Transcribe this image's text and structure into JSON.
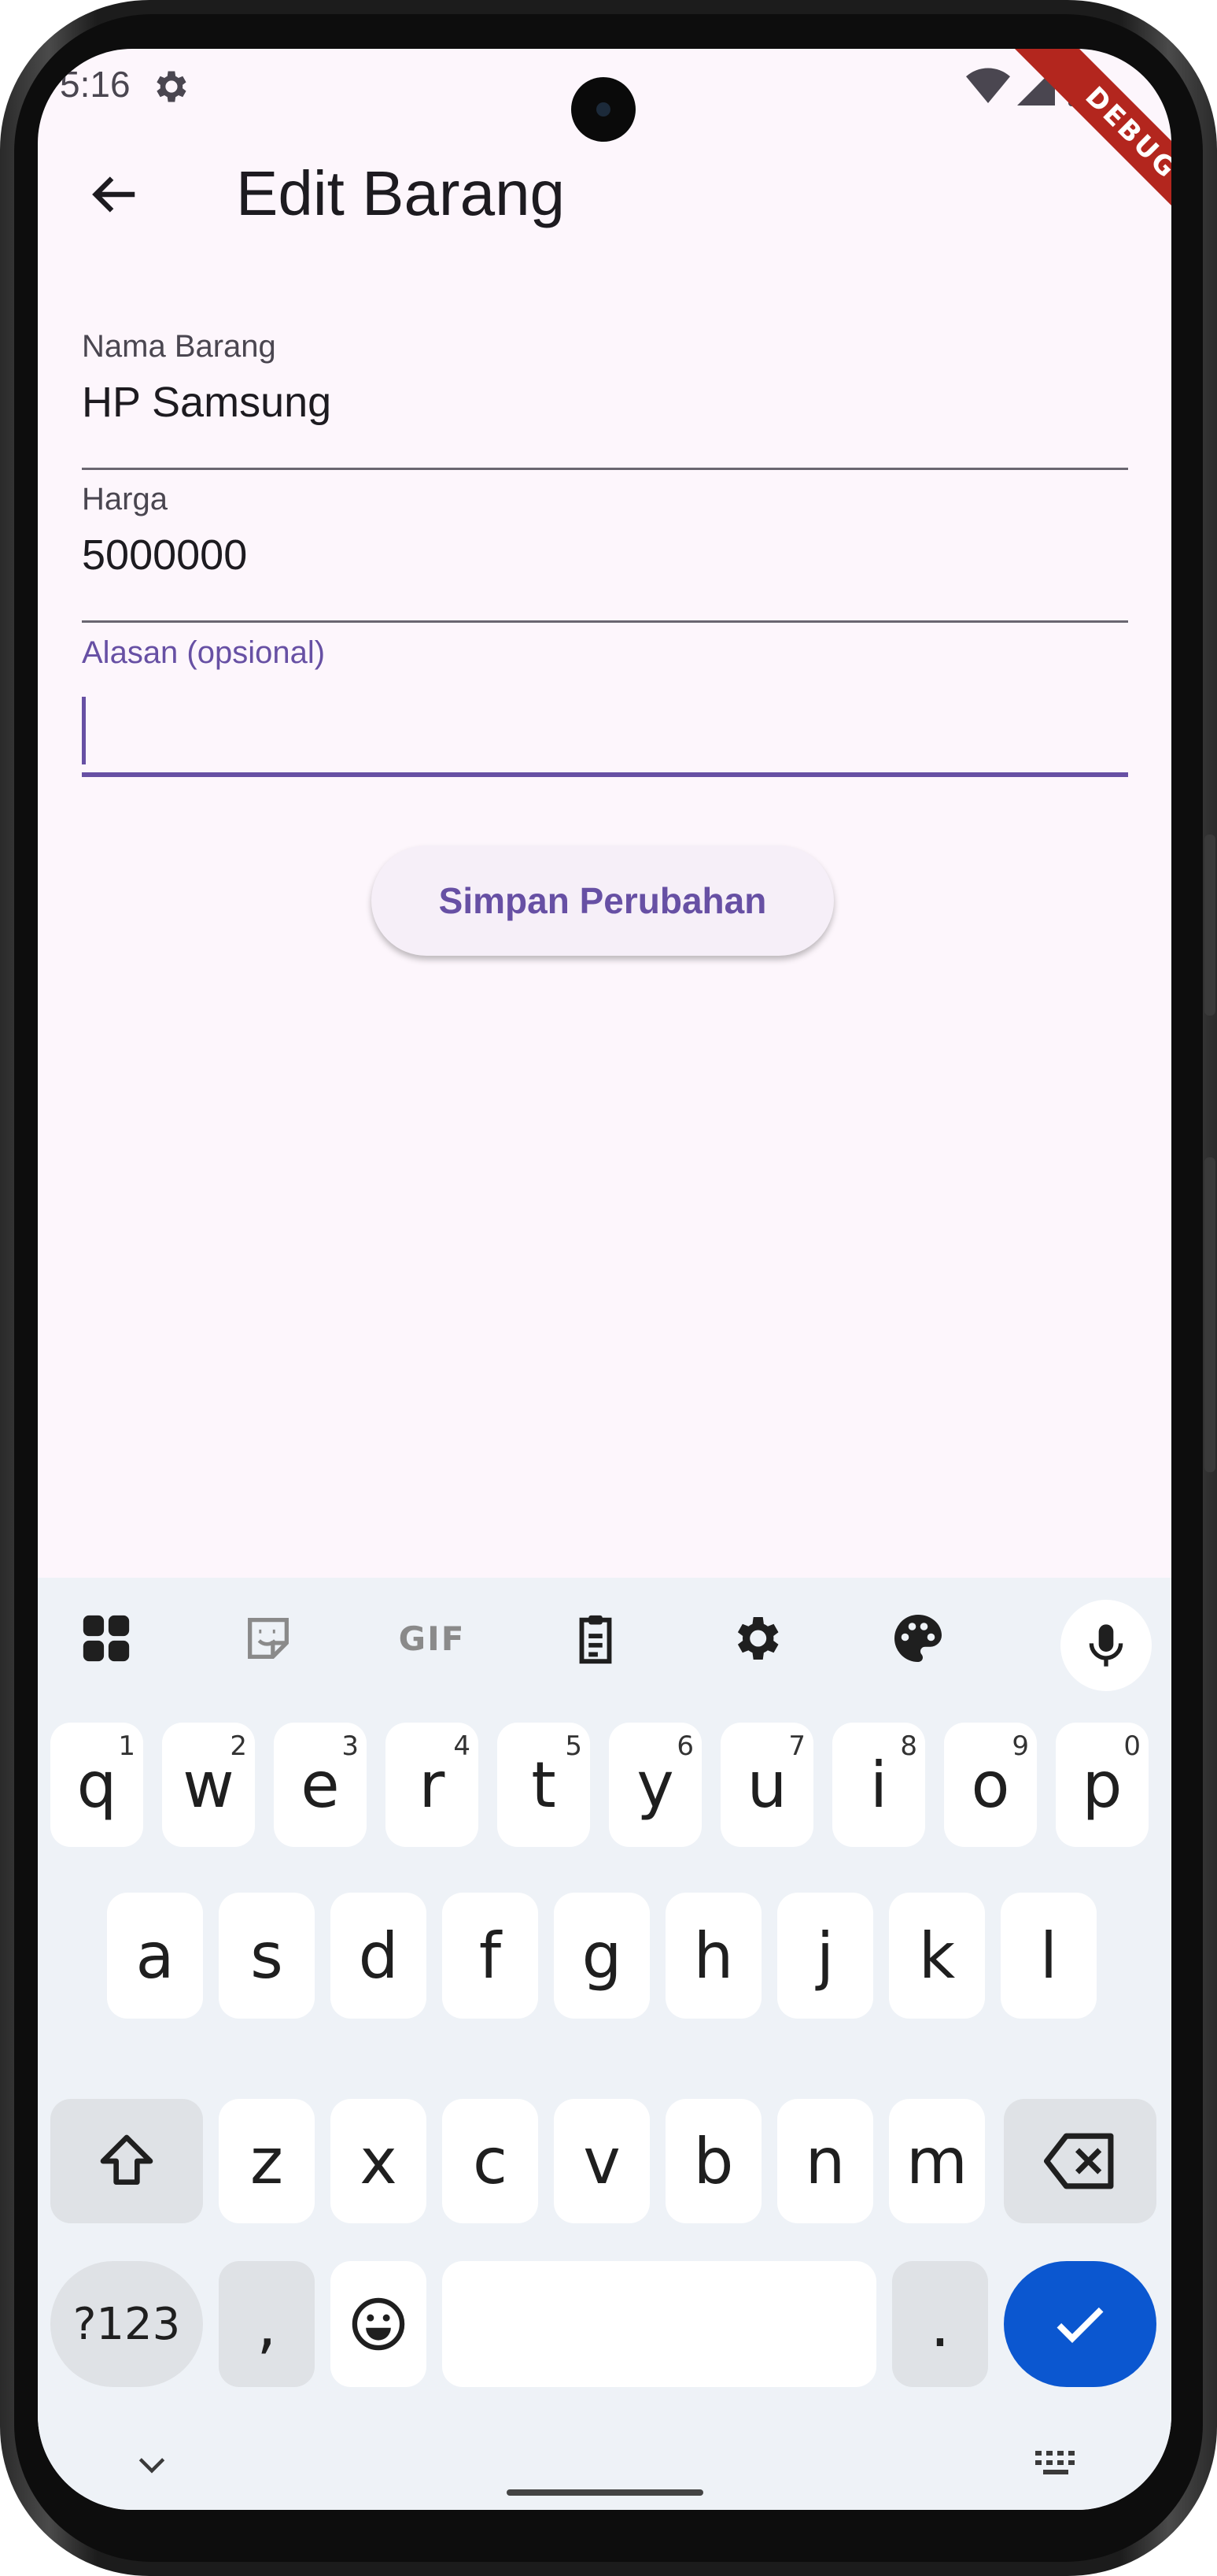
{
  "status_bar": {
    "time": "5:16"
  },
  "debug_banner": "DEBUG",
  "app_bar": {
    "title": "Edit Barang"
  },
  "form": {
    "nama_barang": {
      "label": "Nama Barang",
      "value": "HP Samsung"
    },
    "harga": {
      "label": "Harga",
      "value": "5000000"
    },
    "alasan": {
      "label": "Alasan (opsional)",
      "value": ""
    },
    "submit_label": "Simpan Perubahan"
  },
  "colors": {
    "accent": "#6750a4",
    "background": "#fdf6fc",
    "keyboard_bg": "#eef2f7",
    "enter_key": "#0b57d0"
  },
  "keyboard": {
    "toolbar_icons": [
      "apps-icon",
      "sticker-icon",
      "gif-icon",
      "clipboard-icon",
      "settings-icon",
      "palette-icon",
      "mic-icon"
    ],
    "gif_label": "GIF",
    "row1": [
      {
        "k": "q",
        "h": "1"
      },
      {
        "k": "w",
        "h": "2"
      },
      {
        "k": "e",
        "h": "3"
      },
      {
        "k": "r",
        "h": "4"
      },
      {
        "k": "t",
        "h": "5"
      },
      {
        "k": "y",
        "h": "6"
      },
      {
        "k": "u",
        "h": "7"
      },
      {
        "k": "i",
        "h": "8"
      },
      {
        "k": "o",
        "h": "9"
      },
      {
        "k": "p",
        "h": "0"
      }
    ],
    "row2": [
      "a",
      "s",
      "d",
      "f",
      "g",
      "h",
      "j",
      "k",
      "l"
    ],
    "row3": [
      "z",
      "x",
      "c",
      "v",
      "b",
      "n",
      "m"
    ],
    "symbols_label": "?123",
    "comma": ",",
    "period": "."
  }
}
